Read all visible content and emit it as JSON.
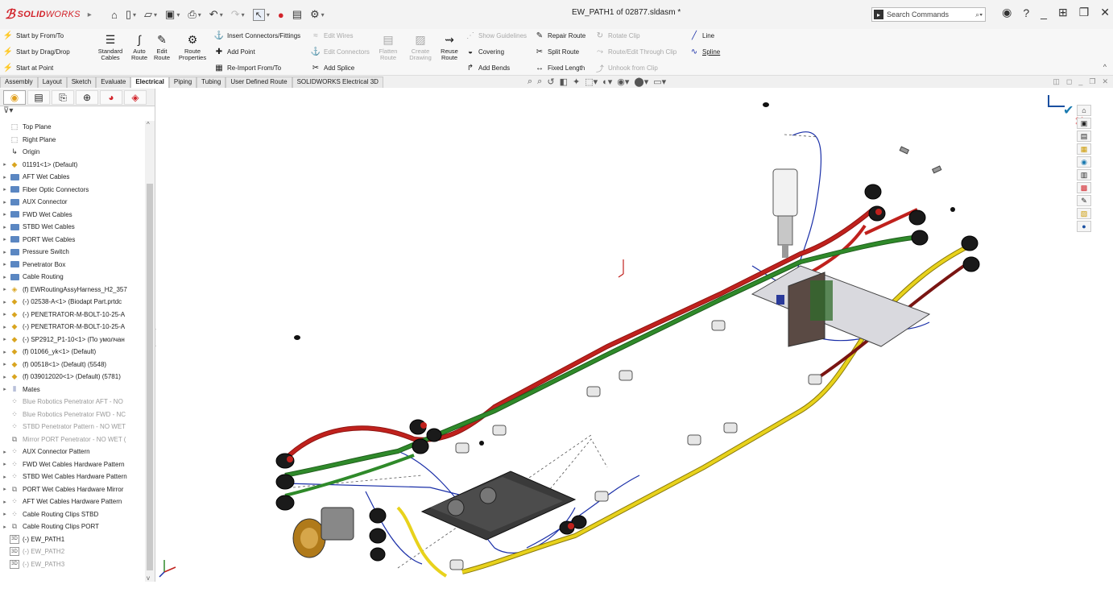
{
  "app": {
    "logo_ds": "ℬ",
    "logo_word_bold": "SOLID",
    "logo_word_light": "WORKS",
    "document_title": "EW_PATH1 of 02877.sldasm *",
    "search_placeholder": "Search Commands"
  },
  "ribbon": {
    "start_from_to": "Start by From/To",
    "start_drag_drop": "Start by Drag/Drop",
    "start_at_point": "Start at Point",
    "standard_cables": "Standard Cables",
    "auto_route": "Auto Route",
    "edit_route": "Edit Route",
    "route_properties": "Route Properties",
    "insert_connectors": "Insert Connectors/Fittings",
    "add_point": "Add Point",
    "reimport": "Re-Import From/To",
    "edit_wires": "Edit Wires",
    "edit_connectors": "Edit Connectors",
    "add_splice": "Add Splice",
    "flatten_route": "Flatten Route",
    "create_drawing": "Create Drawing",
    "reuse_route": "Reuse Route",
    "show_guidelines": "Show Guidelines",
    "covering": "Covering",
    "add_bends": "Add Bends",
    "repair_route": "Repair Route",
    "split_route": "Split Route",
    "fixed_length": "Fixed Length",
    "rotate_clip": "Rotate Clip",
    "route_edit_clip": "Route/Edit Through Clip",
    "unhook_clip": "Unhook from Clip",
    "line": "Line",
    "spline": "Spline"
  },
  "tabs": [
    "Assembly",
    "Layout",
    "Sketch",
    "Evaluate",
    "Electrical",
    "Piping",
    "Tubing",
    "User Defined Route",
    "SOLIDWORKS Electrical 3D"
  ],
  "active_tab": "Electrical",
  "tree": [
    {
      "label": "Top Plane",
      "icon": "plane-icon",
      "expand": false
    },
    {
      "label": "Right Plane",
      "icon": "plane-icon",
      "expand": false
    },
    {
      "label": "Origin",
      "icon": "origin-icon",
      "expand": false
    },
    {
      "label": "01191<1> (Default)",
      "icon": "part-icon",
      "expand": true
    },
    {
      "label": "AFT Wet Cables",
      "icon": "folder-icon",
      "expand": true
    },
    {
      "label": "Fiber Optic Connectors",
      "icon": "folder-icon",
      "expand": true
    },
    {
      "label": "AUX Connector",
      "icon": "folder-icon",
      "expand": true
    },
    {
      "label": "FWD Wet Cables",
      "icon": "folder-icon",
      "expand": true
    },
    {
      "label": "STBD Wet Cables",
      "icon": "folder-icon",
      "expand": true
    },
    {
      "label": "PORT Wet Cables",
      "icon": "folder-icon",
      "expand": true
    },
    {
      "label": "Pressure Switch",
      "icon": "folder-icon",
      "expand": true
    },
    {
      "label": "Penetrator Box",
      "icon": "folder-icon",
      "expand": true
    },
    {
      "label": "Cable Routing",
      "icon": "folder-icon",
      "expand": true
    },
    {
      "label": "(f) EWRoutingAssyHarness_H2_357",
      "icon": "assembly-icon",
      "expand": true
    },
    {
      "label": "(-) 02538-A<1> (Biodapt Part.prtdc",
      "icon": "part-icon",
      "expand": true
    },
    {
      "label": "(-) PENETRATOR-M-BOLT-10-25-A",
      "icon": "part-icon",
      "expand": true
    },
    {
      "label": "(-) PENETRATOR-M-BOLT-10-25-A",
      "icon": "part-icon",
      "expand": true
    },
    {
      "label": "(-) SP2912_P1-10<1> (По умолчан",
      "icon": "part-icon",
      "expand": true
    },
    {
      "label": "(f) 01066_yk<1> (Default)",
      "icon": "part-icon",
      "expand": true
    },
    {
      "label": "(f) 00518<1> (Default) (5548)",
      "icon": "part-icon",
      "expand": true
    },
    {
      "label": "(f) 039012020<1> (Default) (5781)",
      "icon": "part-icon",
      "expand": true
    },
    {
      "label": "Mates",
      "icon": "mates-icon",
      "expand": true
    },
    {
      "label": "Blue Robotics Penetrator AFT - NO",
      "icon": "pattern-icon",
      "expand": false,
      "dim": true
    },
    {
      "label": "Blue Robotics Penetrator FWD - NC",
      "icon": "pattern-icon",
      "expand": false,
      "dim": true
    },
    {
      "label": "STBD Penetrator Pattern - NO WET",
      "icon": "pattern-icon",
      "expand": false,
      "dim": true
    },
    {
      "label": "Mirror PORT Penetrator - NO WET (",
      "icon": "mirror-icon",
      "expand": false,
      "dim": true
    },
    {
      "label": "AUX Connector Pattern",
      "icon": "pattern-icon",
      "expand": true
    },
    {
      "label": "FWD Wet Cables Hardware Pattern",
      "icon": "pattern-icon",
      "expand": true
    },
    {
      "label": "STBD Wet Cables Hardware Pattern",
      "icon": "pattern-icon",
      "expand": true
    },
    {
      "label": "PORT Wet Cables Hardware Mirror",
      "icon": "mirror-icon",
      "expand": true
    },
    {
      "label": "AFT Wet Cables Hardware Pattern",
      "icon": "pattern-icon",
      "expand": true
    },
    {
      "label": "Cable Routing Clips STBD",
      "icon": "pattern-icon",
      "expand": true
    },
    {
      "label": "Cable Routing Clips PORT",
      "icon": "mirror-icon",
      "expand": true
    },
    {
      "label": "(-) EW_PATH1",
      "icon": "sketch3d-icon",
      "expand": false
    },
    {
      "label": "(-) EW_PATH2",
      "icon": "sketch3d-icon",
      "expand": false,
      "dim": true
    },
    {
      "label": "(-) EW_PATH3",
      "icon": "sketch3d-icon",
      "expand": false,
      "dim": true
    }
  ],
  "colors": {
    "cable_red": "#c0211d",
    "cable_green": "#2f8a2a",
    "cable_yellow": "#e8d21c",
    "route_blue": "#1a2fa8",
    "logo_red": "#d2232a"
  }
}
